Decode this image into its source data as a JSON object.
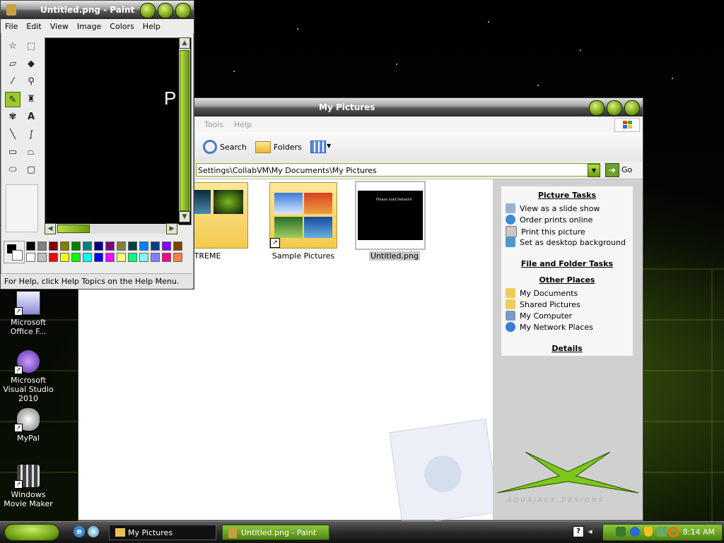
{
  "desktop": {
    "icons": [
      {
        "label": "Microsoft Office F..."
      },
      {
        "label": "Microsoft Visual Studio 2010"
      },
      {
        "label": "MyPal"
      },
      {
        "label": "Windows Movie Maker"
      }
    ]
  },
  "paint": {
    "title": "Untitled.png - Paint",
    "menu": [
      "File",
      "Edit",
      "View",
      "Image",
      "Colors",
      "Help"
    ],
    "canvas_text": "P",
    "status": "For Help, click Help Topics on the Help Menu.",
    "palette_top": [
      "#000000",
      "#808080",
      "#800000",
      "#808000",
      "#008000",
      "#008080",
      "#000080",
      "#800080",
      "#808040",
      "#004040",
      "#0080ff",
      "#004080",
      "#8000ff",
      "#804000"
    ],
    "palette_bottom": [
      "#ffffff",
      "#c0c0c0",
      "#ff0000",
      "#ffff00",
      "#00ff00",
      "#00ffff",
      "#0000ff",
      "#ff00ff",
      "#ffff80",
      "#00ff80",
      "#80ffff",
      "#8080ff",
      "#ff0080",
      "#ff8040"
    ]
  },
  "mypictures": {
    "title": "My Pictures",
    "menu": [
      "Tools",
      "Help"
    ],
    "toolbar": {
      "search": "Search",
      "folders": "Folders"
    },
    "address": "Settings\\CollabVM\\My Documents\\My Pictures",
    "go_label": "Go",
    "items": [
      {
        "label": "BOX XTREME"
      },
      {
        "label": "Sample Pictures"
      },
      {
        "label": "Untitled.png",
        "preview_text": "Please load Network"
      }
    ],
    "tasks": {
      "picture_tasks_title": "Picture Tasks",
      "picture_tasks": [
        "View as a slide show",
        "Order prints online",
        "Print this picture",
        "Set as desktop background"
      ],
      "file_folder_title": "File and Folder Tasks",
      "other_places_title": "Other Places",
      "other_places": [
        "My Documents",
        "Shared Pictures",
        "My Computer",
        "My Network Places"
      ],
      "details_title": "Details"
    },
    "watermark": "AQUAJACK DESIGNS"
  },
  "taskbar": {
    "items": [
      "My Pictures",
      "Untitled.png - Paint"
    ],
    "clock": "8:14 AM"
  }
}
